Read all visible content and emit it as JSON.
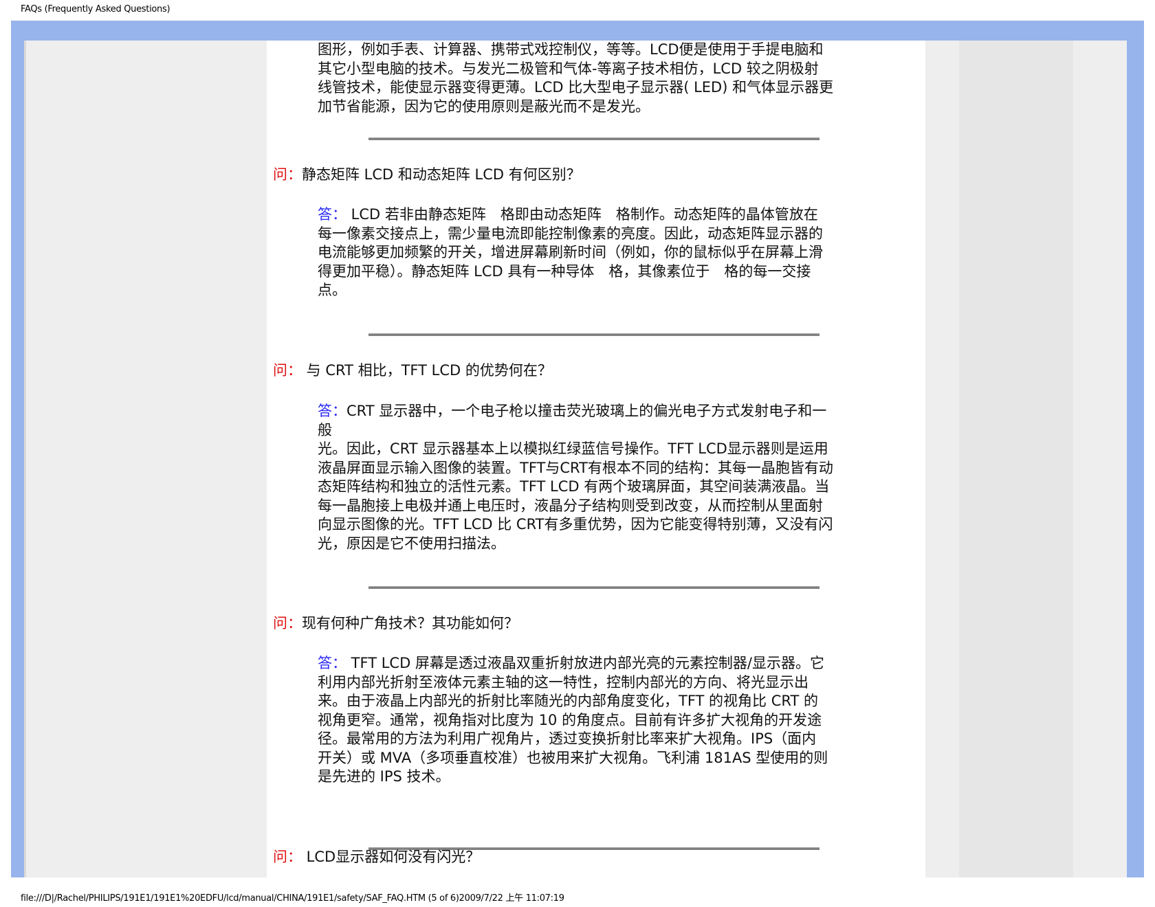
{
  "header": {
    "title": "FAQs (Frequently Asked Questions)"
  },
  "footer": {
    "path": "file:///D|/Rachel/PHILIPS/191E1/191E1%20EDFU/lcd/manual/CHINA/191E1/safety/SAF_FAQ.HTM (5 of 6)2009/7/22 上午 11:07:19"
  },
  "content": {
    "intro": {
      "lines": [
        "图形，例如手表、计算器、携带式戏控制仪，等等。LCD便是使用于手提电脑和",
        "其它小型电脑的技术。与发光二极管和气体-等离子技术相仿，LCD 较之阴极射",
        "线管技术，能使显示器变得更薄。LCD 比大型电子显示器( LED) 和气体显示器更",
        "加节省能源，因为它的使用原则是蔽光而不是发光。"
      ]
    },
    "faqs": [
      {
        "q_label": "问：",
        "question": "静态矩阵 LCD 和动态矩阵 LCD 有何区别？",
        "a_label": "答：",
        "answer_first": " LCD 若非由静态矩阵　格即由动态矩阵　格制作。动态矩阵的晶体管放在",
        "answer_lines": [
          "每一像素交接点上，需少量电流即能控制像素的亮度。因此，动态矩阵显示器的",
          "电流能够更加频繁的开关，增进屏幕刷新时间（例如，你的鼠标似乎在屏幕上滑",
          "得更加平稳）。静态矩阵 LCD 具有一种导体　格，其像素位于　格的每一交接",
          "点。"
        ]
      },
      {
        "q_label": "问：",
        "question": " 与 CRT 相比，TFT LCD 的优势何在？",
        "a_label": "答：",
        "answer_first": "CRT 显示器中，一个电子枪以撞击荧光玻璃上的偏光电子方式发射电子和一",
        "answer_lines": [
          "般",
          "光。因此，CRT 显示器基本上以模拟红绿蓝信号操作。TFT LCD显示器则是运用",
          "液晶屏面显示输入图像的装置。TFT与CRT有根本不同的结构：其每一晶胞皆有动",
          "态矩阵结构和独立的活性元素。TFT LCD 有两个玻璃屏面，其空间装满液晶。当",
          "每一晶胞接上电极并通上电压时，液晶分子结构则受到改变，从而控制从里面射",
          "向显示图像的光。TFT LCD 比 CRT有多重优势，因为它能变得特别薄，又没有闪",
          "光，原因是它不使用扫描法。"
        ]
      },
      {
        "q_label": "问：",
        "question": "现有何种广角技术？其功能如何？",
        "a_label": "答：",
        "answer_first": " TFT LCD 屏幕是透过液晶双重折射放进内部光亮的元素控制器/显示器。它",
        "answer_lines": [
          "利用内部光折射至液体元素主轴的这一特性，控制内部光的方向、将光显示出",
          "来。由于液晶上内部光的折射比率随光的内部角度变化，TFT 的视角比 CRT 的",
          "视角更窄。通常，视角指对比度为 10 的角度点。目前有许多扩大视角的开发途",
          "径。最常用的方法为利用广视角片，透过变换折射比率来扩大视角。IPS（面内",
          "开关）或 MVA（多项垂直校准）也被用来扩大视角。飞利浦 181AS 型使用的则",
          "是先进的 IPS 技术。"
        ]
      },
      {
        "q_label": "问：",
        "question": " LCD显示器如何没有闪光？"
      }
    ]
  }
}
